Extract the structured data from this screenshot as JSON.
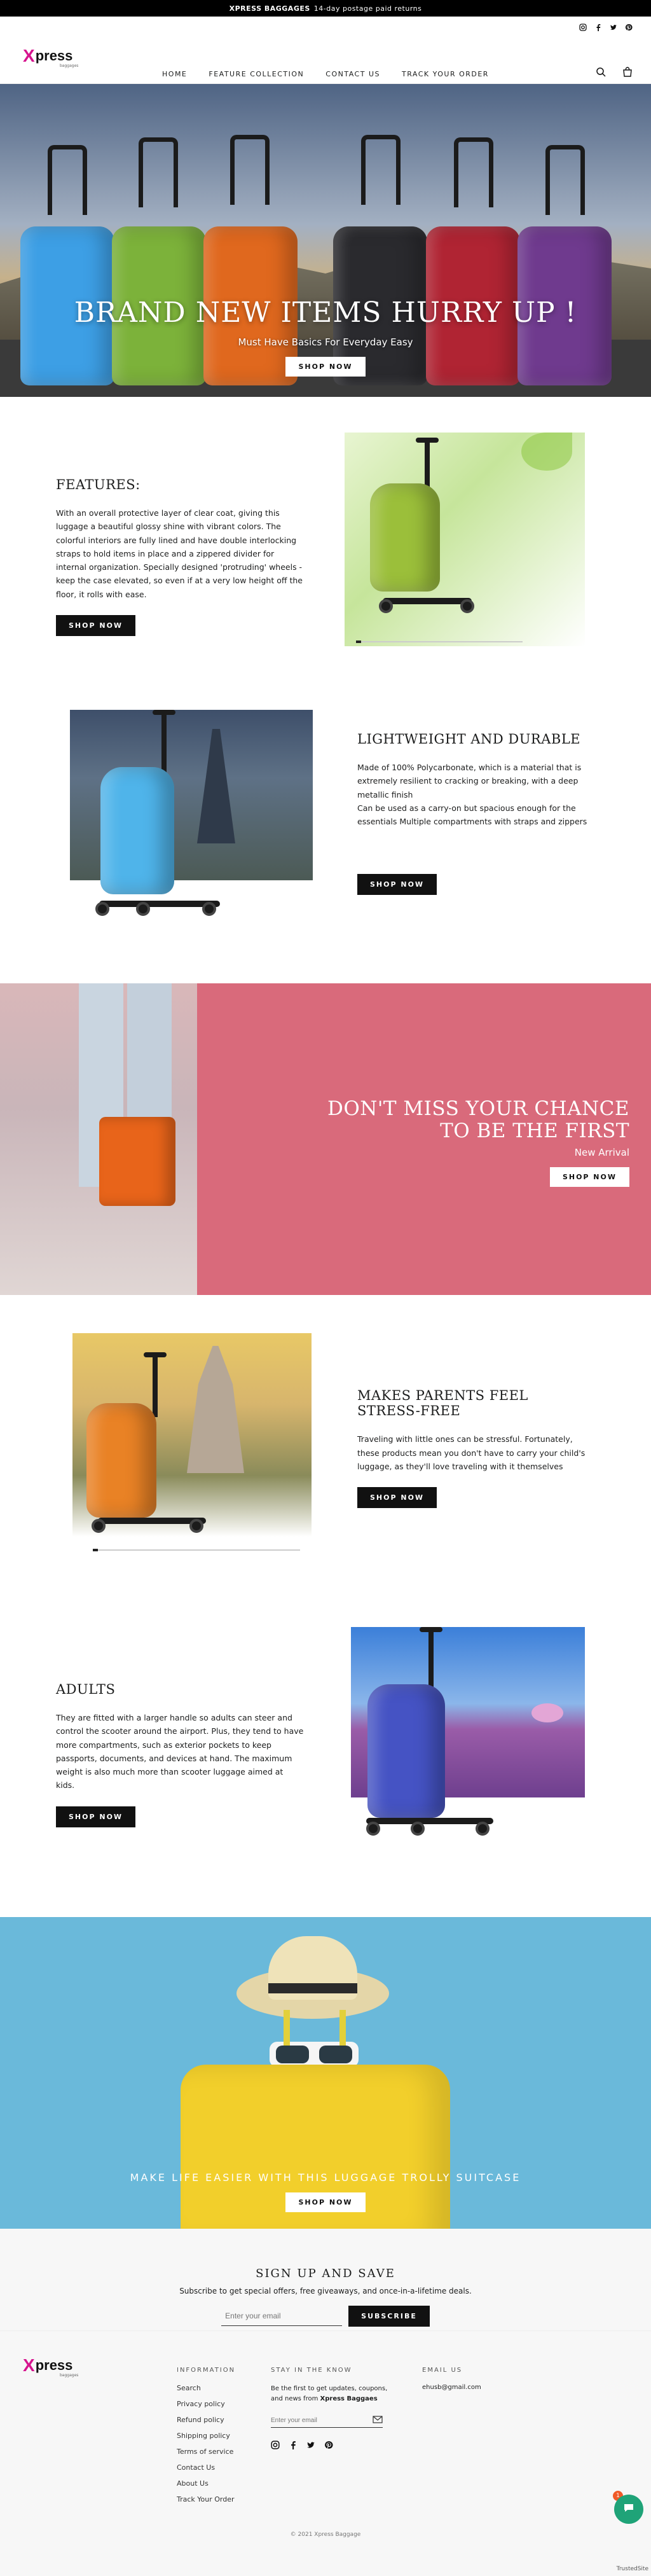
{
  "announcement": {
    "brand": "XPRESS BAGGAGES",
    "text": "14-day postage paid returns"
  },
  "header": {
    "logo_x": "X",
    "logo_rest": "press",
    "logo_sub": "baggages",
    "nav": [
      "HOME",
      "FEATURE COLLECTION",
      "CONTACT US",
      "TRACK YOUR ORDER"
    ]
  },
  "hero": {
    "title": "BRAND NEW ITEMS HURRY UP !",
    "subtitle": "Must Have Basics For Everyday Easy",
    "button": "SHOP NOW"
  },
  "features": [
    {
      "title": "FEATURES:",
      "body": "With an overall protective layer of clear coat, giving this luggage a beautiful glossy shine with vibrant colors. The colorful interiors are fully lined and have double interlocking straps to hold items in place and a zippered divider for internal organization. Specially designed 'protruding' wheels - keep the case elevated, so even if at a very low height off the floor, it rolls with ease.",
      "button": "SHOP NOW"
    },
    {
      "title": "LIGHTWEIGHT AND DURABLE",
      "body": " Made of 100% Polycarbonate, which is a material that is extremely resilient to cracking or breaking, with a deep metallic finish\nCan be used as a carry-on but spacious enough for the essentials Multiple compartments with straps and zippers",
      "button": "SHOP NOW"
    }
  ],
  "promo": {
    "title_line1": "DON'T MISS YOUR CHANCE",
    "title_line2": "TO BE THE FIRST",
    "subtitle": "New Arrival",
    "button": "SHOP NOW"
  },
  "features2": [
    {
      "title": "MAKES PARENTS FEEL STRESS-FREE",
      "body": "Traveling with little ones can be stressful. Fortunately, these products mean you don't have to carry your child's luggage, as they'll love traveling with it themselves",
      "button": "SHOP NOW"
    },
    {
      "title": "ADULTS",
      "body": "They are fitted with a larger handle so adults can steer and control the scooter around the airport. Plus, they tend to have more compartments, such as exterior pockets to keep passports, documents, and devices at hand. The maximum weight is also much more than scooter luggage aimed at kids.",
      "button": "SHOP NOW"
    }
  ],
  "banner": {
    "title": "MAKE LIFE EASIER WITH THIS LUGGAGE TROLLY SUITCASE",
    "button": "SHOP NOW"
  },
  "newsletter": {
    "title": "SIGN UP AND SAVE",
    "subtitle": "Subscribe to get special offers, free giveaways, and once-in-a-lifetime deals.",
    "placeholder": "Enter your email",
    "button": "SUBSCRIBE"
  },
  "footer": {
    "info_heading": "INFORMATION",
    "info_links": [
      "Search",
      "Privacy policy",
      "Refund policy",
      "Shipping policy",
      "Terms of service",
      "Contact Us",
      "About Us",
      "Track Your Order"
    ],
    "stay_heading": "STAY IN THE KNOW",
    "stay_text": "Be the first to get updates, coupons, and news from",
    "stay_brand": "Xpress Baggaes",
    "stay_placeholder": "Enter your email",
    "email_heading": "EMAIL US",
    "email": "ehusb@gmail.com",
    "copyright": "© 2021 Xpress Baggage",
    "chat_badge": "1",
    "trusted": "TrustedSite"
  },
  "colors": {
    "accent": "#d6148e",
    "promo_bg": "#d96a7b",
    "banner_bg": "#6ab9da",
    "chat": "#1fa378"
  }
}
